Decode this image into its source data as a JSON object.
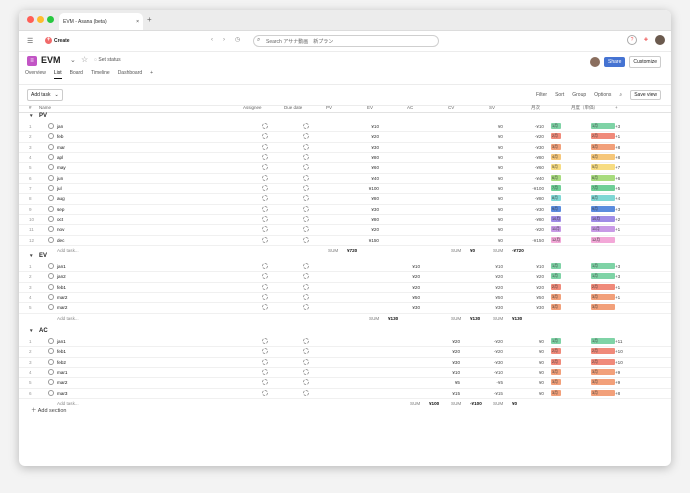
{
  "browser": {
    "tab_title": "EVM - Asana (beta)",
    "new_tab": "+"
  },
  "topbar": {
    "create_label": "Create",
    "search_placeholder": "Search アサナ動画　新プラン"
  },
  "project": {
    "name": "EVM",
    "set_status": "Set status",
    "share": "Share",
    "customize": "Customize"
  },
  "views": [
    "Overview",
    "List",
    "Board",
    "Timeline",
    "Dashboard"
  ],
  "toolbar": {
    "add_task": "Add task",
    "filter": "Filter",
    "sort": "Sort",
    "group": "Group",
    "options": "Options",
    "save_view": "Save view"
  },
  "columns": {
    "name": "Name",
    "assignee": "Assignee",
    "due": "Due date",
    "pv": "PV",
    "ev": "EV",
    "ac": "AC",
    "cv": "CV",
    "sv": "SV",
    "m1": "月次",
    "m2": "月度（単価）",
    "plus": "+"
  },
  "sections": [
    {
      "title": "PV",
      "rows": [
        {
          "i": "1",
          "name": "jan",
          "pv": "¥10",
          "ev": "",
          "ac": "",
          "cv": "¥0",
          "sv": "-¥10",
          "m1": "1月",
          "m2": "1月",
          "m3": "+3"
        },
        {
          "i": "2",
          "name": "feb",
          "pv": "¥20",
          "ev": "",
          "ac": "",
          "cv": "¥0",
          "sv": "-¥20",
          "m1": "2月",
          "m2": "2月",
          "m3": "+1"
        },
        {
          "i": "3",
          "name": "mar",
          "pv": "¥30",
          "ev": "",
          "ac": "",
          "cv": "¥0",
          "sv": "-¥30",
          "m1": "3月",
          "m2": "3月",
          "m3": "+8"
        },
        {
          "i": "4",
          "name": "apl",
          "pv": "¥80",
          "ev": "",
          "ac": "",
          "cv": "¥0",
          "sv": "-¥80",
          "m1": "4月",
          "m2": "4月",
          "m3": "+8"
        },
        {
          "i": "5",
          "name": "may",
          "pv": "¥60",
          "ev": "",
          "ac": "",
          "cv": "¥0",
          "sv": "-¥60",
          "m1": "5月",
          "m2": "5月",
          "m3": "+7"
        },
        {
          "i": "6",
          "name": "jun",
          "pv": "¥40",
          "ev": "",
          "ac": "",
          "cv": "¥0",
          "sv": "-¥40",
          "m1": "6月",
          "m2": "6月",
          "m3": "+6"
        },
        {
          "i": "7",
          "name": "jul",
          "pv": "¥100",
          "ev": "",
          "ac": "",
          "cv": "¥0",
          "sv": "-¥100",
          "m1": "7月",
          "m2": "7月",
          "m3": "+5"
        },
        {
          "i": "8",
          "name": "aug",
          "pv": "¥80",
          "ev": "",
          "ac": "",
          "cv": "¥0",
          "sv": "-¥80",
          "m1": "8月",
          "m2": "8月",
          "m3": "+4"
        },
        {
          "i": "9",
          "name": "sep",
          "pv": "¥30",
          "ev": "",
          "ac": "",
          "cv": "¥0",
          "sv": "-¥30",
          "m1": "9月",
          "m2": "9月",
          "m3": "+3"
        },
        {
          "i": "10",
          "name": "oct",
          "pv": "¥80",
          "ev": "",
          "ac": "",
          "cv": "¥0",
          "sv": "-¥80",
          "m1": "10月",
          "m2": "10月",
          "m3": "+2"
        },
        {
          "i": "11",
          "name": "nov",
          "pv": "¥20",
          "ev": "",
          "ac": "",
          "cv": "¥0",
          "sv": "-¥20",
          "m1": "11月",
          "m2": "11月",
          "m3": "+1"
        },
        {
          "i": "12",
          "name": "dec",
          "pv": "¥150",
          "ev": "",
          "ac": "",
          "cv": "¥0",
          "sv": "-¥150",
          "m1": "12月",
          "m2": "12月",
          "m3": ""
        }
      ],
      "add": "Add task...",
      "sum_pv": "¥720",
      "sum_cv": "¥0",
      "sum_sv": "-¥720",
      "sum_ev": "",
      "sum_ac": ""
    },
    {
      "title": "EV",
      "rows": [
        {
          "i": "1",
          "name": "jan1",
          "pv": "",
          "ev": "¥10",
          "ac": "",
          "cv": "¥10",
          "sv": "¥10",
          "m1": "1月",
          "m2": "1月",
          "m3": "+3"
        },
        {
          "i": "2",
          "name": "jan2",
          "pv": "",
          "ev": "¥20",
          "ac": "",
          "cv": "¥20",
          "sv": "¥20",
          "m1": "1月",
          "m2": "1月",
          "m3": "+3"
        },
        {
          "i": "3",
          "name": "feb1",
          "pv": "",
          "ev": "¥20",
          "ac": "",
          "cv": "¥20",
          "sv": "¥20",
          "m1": "2月",
          "m2": "2月",
          "m3": "+1"
        },
        {
          "i": "4",
          "name": "mar2",
          "pv": "",
          "ev": "¥50",
          "ac": "",
          "cv": "¥50",
          "sv": "¥50",
          "m1": "3月",
          "m2": "3月",
          "m3": "+1"
        },
        {
          "i": "5",
          "name": "mar2",
          "pv": "",
          "ev": "¥30",
          "ac": "",
          "cv": "¥30",
          "sv": "¥30",
          "m1": "3月",
          "m2": "3月",
          "m3": ""
        }
      ],
      "add": "Add task...",
      "sum_pv": "",
      "sum_ev": "¥130",
      "sum_cv": "¥130",
      "sum_sv": "¥130",
      "sum_ac": ""
    },
    {
      "title": "AC",
      "rows": [
        {
          "i": "1",
          "name": "jan1",
          "pv": "",
          "ev": "",
          "ac": "¥20",
          "cv": "-¥20",
          "sv": "¥0",
          "m1": "1月",
          "m2": "1月",
          "m3": "+11"
        },
        {
          "i": "2",
          "name": "feb1",
          "pv": "",
          "ev": "",
          "ac": "¥20",
          "cv": "-¥20",
          "sv": "¥0",
          "m1": "2月",
          "m2": "2月",
          "m3": "+10"
        },
        {
          "i": "3",
          "name": "feb2",
          "pv": "",
          "ev": "",
          "ac": "¥30",
          "cv": "-¥30",
          "sv": "¥0",
          "m1": "2月",
          "m2": "2月",
          "m3": "+10"
        },
        {
          "i": "4",
          "name": "mar1",
          "pv": "",
          "ev": "",
          "ac": "¥10",
          "cv": "-¥10",
          "sv": "¥0",
          "m1": "3月",
          "m2": "3月",
          "m3": "+9"
        },
        {
          "i": "5",
          "name": "mar2",
          "pv": "",
          "ev": "",
          "ac": "¥5",
          "cv": "-¥5",
          "sv": "¥0",
          "m1": "3月",
          "m2": "3月",
          "m3": "+9"
        },
        {
          "i": "6",
          "name": "mar3",
          "pv": "",
          "ev": "",
          "ac": "¥15",
          "cv": "-¥15",
          "sv": "¥0",
          "m1": "3月",
          "m2": "3月",
          "m3": "+8"
        }
      ],
      "add": "Add task...",
      "sum_pv": "",
      "sum_ev": "",
      "sum_ac": "¥100",
      "sum_cv": "-¥100",
      "sum_sv": "¥0"
    }
  ],
  "sum_label": "SUM",
  "add_section": "Add section",
  "month_colors": {
    "1月": "#7fd3a6",
    "2月": "#f08a7a",
    "3月": "#f2a07a",
    "4月": "#f6c77a",
    "5月": "#f7dc82",
    "6月": "#a8dc7e",
    "7月": "#6fcf97",
    "8月": "#7fd7d4",
    "9月": "#5b8cde",
    "10月": "#9f8ce6",
    "11月": "#c89ae6",
    "12月": "#f3a8d8"
  }
}
